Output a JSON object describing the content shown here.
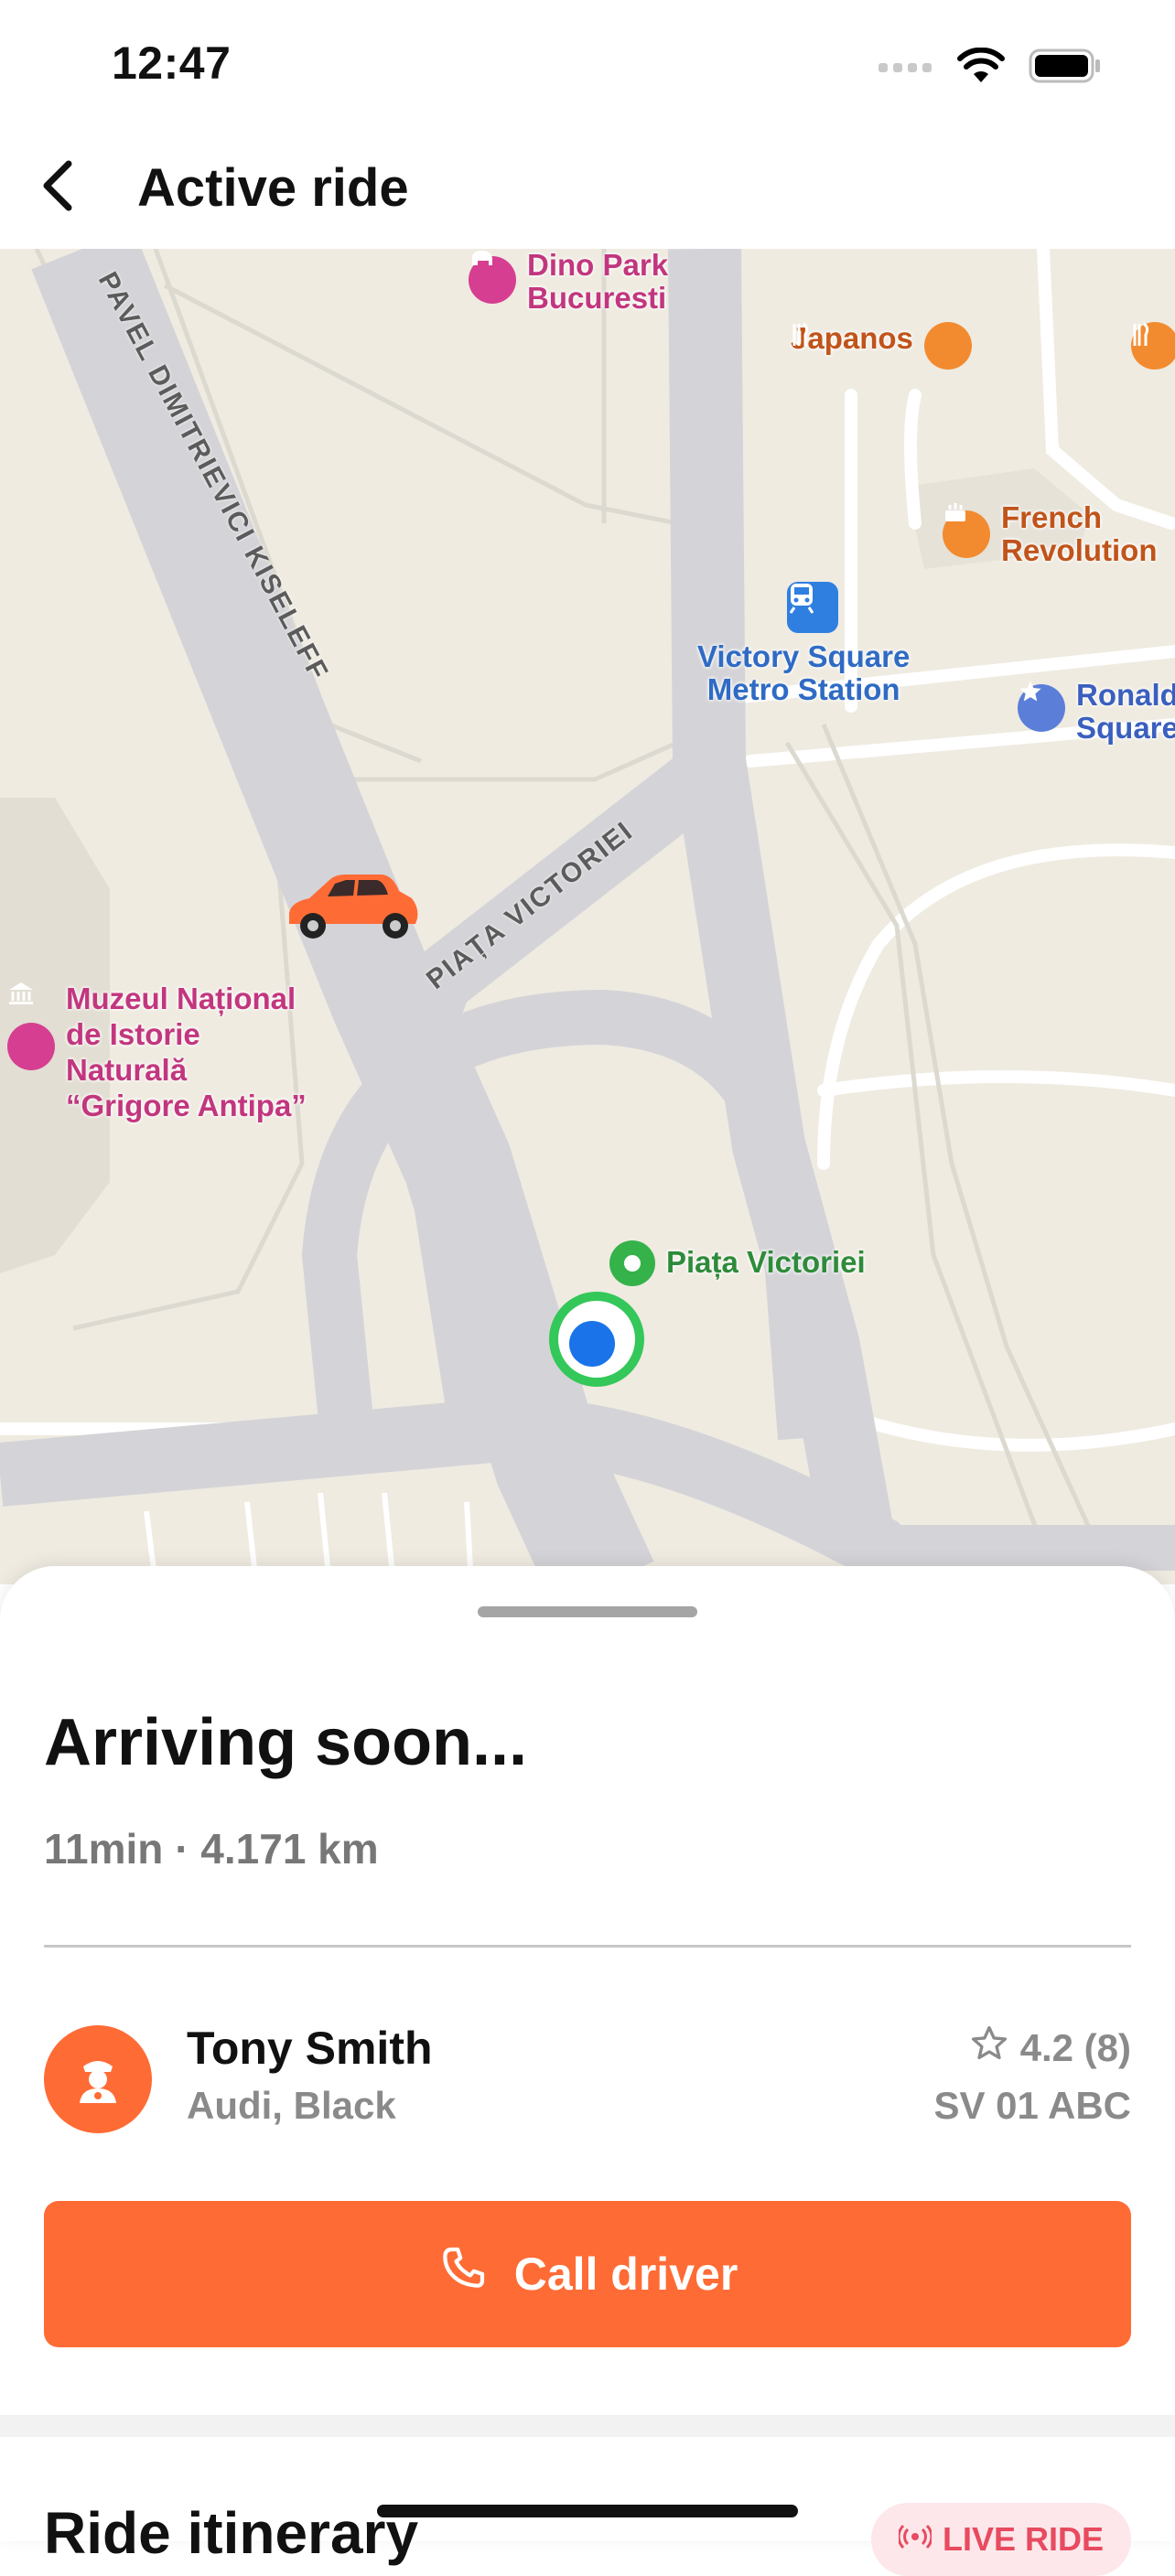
{
  "status_bar": {
    "time": "12:47"
  },
  "nav": {
    "title": "Active ride"
  },
  "map": {
    "pois": {
      "dino_park": "Dino Park\nBucuresti",
      "japanos": "Japanos",
      "french_revolution": "French\nRevolution",
      "metro_station": "Victory Square\nMetro Station",
      "ronald_square": "Ronald\nSquare",
      "museum": "Muzeul Național\nde Istorie\nNaturală\n“Grigore Antipa”",
      "piata_victoriei": "Piața Victoriei"
    },
    "roads": {
      "kiseleff": "PAVEL DIMITRIEVICI KISELEFF",
      "piata_victoriei": "PIAȚA VICTORIEI"
    },
    "colors": {
      "car": "#ff6b35",
      "user_dot": "#1a73e8",
      "user_ring": "#34c759"
    }
  },
  "sheet": {
    "status": "Arriving soon...",
    "eta": "11min · 4.171 km",
    "driver": {
      "name": "Tony Smith",
      "car": "Audi, Black",
      "rating": "4.2 (8)",
      "plate": "SV 01 ABC"
    },
    "call_label": "Call driver",
    "itinerary_title": "Ride itinerary",
    "live_badge": "LIVE RIDE"
  },
  "colors": {
    "accent": "#ff6b35",
    "live_badge_text": "#e84a5f"
  }
}
